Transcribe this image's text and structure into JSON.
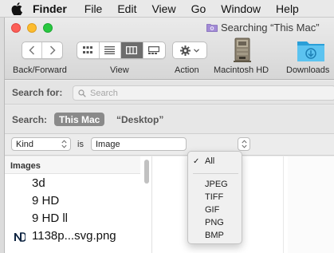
{
  "menubar": {
    "apple_icon": "apple-logo-icon",
    "items": [
      "Finder",
      "File",
      "Edit",
      "View",
      "Go",
      "Window",
      "Help"
    ]
  },
  "window": {
    "title": "Searching “This Mac”",
    "title_icon": "smart-folder-icon"
  },
  "toolbar": {
    "back_forward_label": "Back/Forward",
    "view_label": "View",
    "action_label": "Action",
    "macintosh_hd_label": "Macintosh HD",
    "downloads_label": "Downloads",
    "active_view": "columns"
  },
  "search": {
    "label": "Search for:",
    "placeholder": "Search",
    "value": ""
  },
  "scope": {
    "label": "Search:",
    "selected": "This Mac",
    "other": "“Desktop”"
  },
  "criteria": {
    "attribute": "Kind",
    "operator": "is",
    "value": "Image"
  },
  "results": {
    "column_header": "Images",
    "items": [
      {
        "name": "3d",
        "icon": ""
      },
      {
        "name": "9 HD",
        "icon": ""
      },
      {
        "name": "9 HD ll",
        "icon": ""
      },
      {
        "name": "1138p...svg.png",
        "icon": "notre-dame-logo-icon"
      }
    ]
  },
  "dropdown": {
    "selected": "All",
    "options": [
      "All",
      "JPEG",
      "TIFF",
      "GIF",
      "PNG",
      "BMP"
    ]
  },
  "colors": {
    "close": "#fc5f57",
    "minimize": "#fdbc2e",
    "zoom": "#28c840",
    "downloads_blue": "#3db3e8",
    "scope_selected": "#8a8a8a"
  }
}
